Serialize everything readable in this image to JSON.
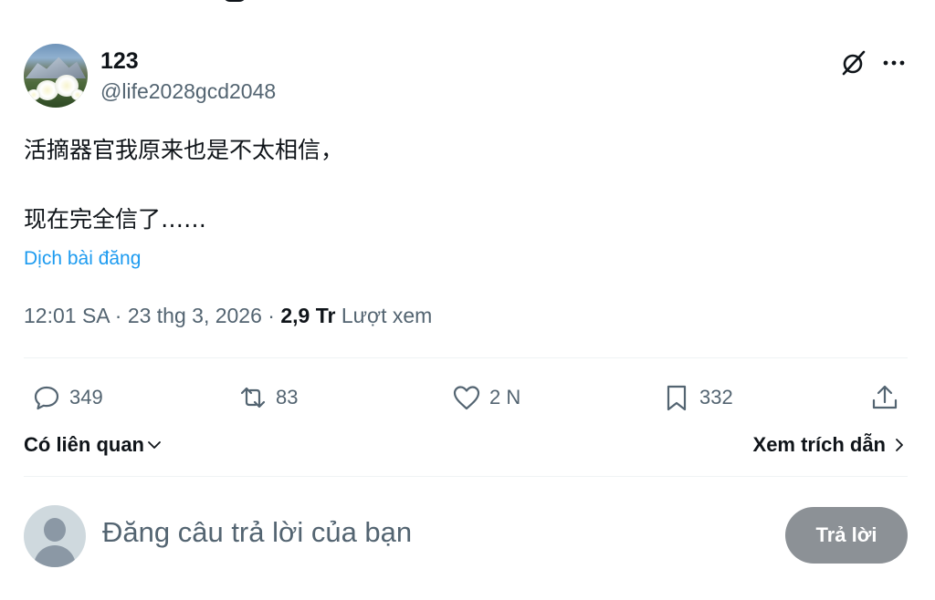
{
  "tweet": {
    "author": {
      "name": "123",
      "handle": "@life2028gcd2048"
    },
    "icons": {
      "grok": "grok-slash-circle-icon",
      "more": "more-horizontal-icon"
    },
    "text": "活摘器官我原来也是不太相信，\n\n现在完全信了……",
    "translate_label": "Dịch bài đăng",
    "meta": {
      "time": "12:01 SA",
      "separator": " · ",
      "date": "23 thg 3, 2026",
      "views_count": "2,9 Tr",
      "views_label": " Lượt xem"
    },
    "actions": {
      "replies": "349",
      "retweets": "83",
      "likes": "2 N",
      "bookmarks": "332"
    },
    "related_label": "Có liên quan",
    "view_quotes_label": "Xem trích dẫn"
  },
  "reply": {
    "placeholder": "Đăng câu trả lời của bạn",
    "button_label": "Trả lời"
  },
  "colors": {
    "text": "#0f1419",
    "secondary": "#536471",
    "link": "#1d9bf0",
    "divider": "#eff3f4",
    "button_disabled": "#8c9196"
  }
}
